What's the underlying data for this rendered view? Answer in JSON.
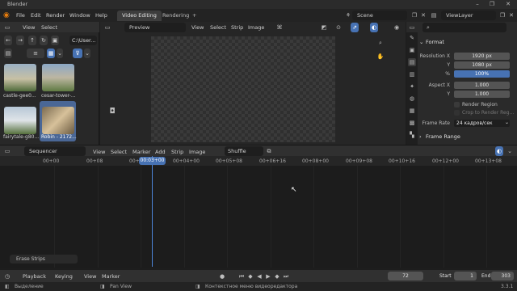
{
  "window": {
    "title": "Blender"
  },
  "menubar": {
    "menus": [
      "File",
      "Edit",
      "Render",
      "Window",
      "Help"
    ],
    "tabs": [
      "Video Editing",
      "Rendering"
    ],
    "add_tab": "+",
    "scene": "Scene",
    "view_layer": "ViewLayer"
  },
  "file_browser": {
    "view": "View",
    "select": "Select",
    "path": "C:\\User...",
    "thumbnails": [
      {
        "caption": "castle-gee0...",
        "selected": false
      },
      {
        "caption": "cesar-tower-...",
        "selected": false
      },
      {
        "caption": "fairytale-g80...",
        "selected": false
      },
      {
        "caption": "Robin - 2172...",
        "selected": true
      }
    ]
  },
  "preview": {
    "mode": "Preview",
    "menus": [
      "View",
      "Select",
      "Strip",
      "Image"
    ]
  },
  "properties": {
    "panel_format": "Format",
    "resolution_x_label": "Resolution X",
    "resolution_x": "1920 px",
    "y_label": "Y",
    "resolution_y": "1080 px",
    "percent_label": "%",
    "percent": "100%",
    "aspect_x_label": "Aspect X",
    "aspect_x": "1.000",
    "aspect_y_label": "Y",
    "aspect_y": "1.000",
    "render_region": "Render Region",
    "crop_region": "Crop to Render Reg...",
    "frame_rate_label": "Frame Rate",
    "frame_rate": "24 кадров/сек",
    "panel_frame_range": "Frame Range"
  },
  "sequencer": {
    "mode": "Sequencer",
    "menus": [
      "View",
      "Select",
      "Marker",
      "Add",
      "Strip",
      "Image"
    ],
    "snap_mode": "Shuffle",
    "ticks": [
      "00+00",
      "00+08",
      "00+16",
      "00+03+00",
      "00+04+00",
      "00+05+08",
      "00+06+16",
      "00+08+00",
      "00+09+08",
      "00+10+16",
      "00+12+00",
      "00+13+08"
    ],
    "current_frame_label": "00:03+00",
    "last_operator": "Erase Strips"
  },
  "timeline": {
    "playback": "Playback",
    "keying": "Keying",
    "view": "View",
    "marker": "Marker",
    "current_frame": "72",
    "start_label": "Start",
    "start": "1",
    "end_label": "End",
    "end": "303"
  },
  "status": {
    "select": "Выделение",
    "pan": "Pan View",
    "context": "Контекстное меню видеоредактора",
    "version": "3.3.1"
  }
}
